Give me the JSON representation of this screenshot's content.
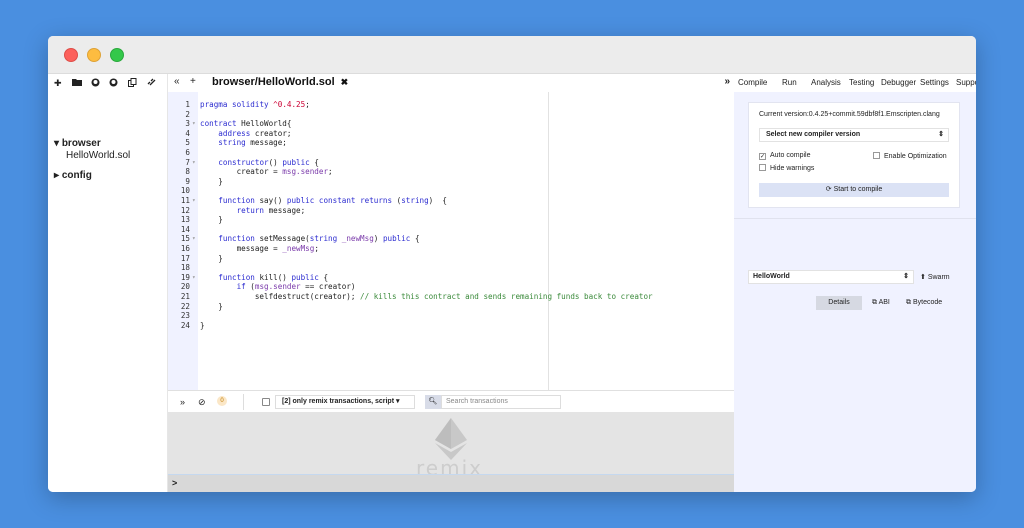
{
  "window": {
    "traffic_lights": [
      "close",
      "minimize",
      "maximize"
    ]
  },
  "explorer": {
    "toolbar_icons": [
      "plus-icon",
      "folder-open-icon",
      "github-icon",
      "github-publish-icon",
      "copy-icon",
      "link-icon"
    ],
    "tree": [
      {
        "type": "folder",
        "label": "browser",
        "expanded": true
      },
      {
        "type": "file",
        "label": "HelloWorld.sol"
      },
      {
        "type": "folder",
        "label": "config",
        "expanded": false
      }
    ]
  },
  "editor": {
    "tab": {
      "label": "browser/HelloWorld.sol",
      "close": "✖"
    },
    "lines": [
      "pragma solidity ^0.4.25;",
      "",
      "contract HelloWorld{",
      "    address creator;",
      "    string message;",
      "",
      "    constructor() public {",
      "        creator = msg.sender;",
      "    }",
      "",
      "    function say() public constant returns (string)  {",
      "        return message;",
      "    }",
      "",
      "    function setMessage(string _newMsg) public {",
      "        message = _newMsg;",
      "    }",
      "",
      "    function kill() public {",
      "        if (msg.sender == creator)",
      "            selfdestruct(creator); // kills this contract and sends remaining funds back to creator",
      "    }",
      "",
      "}"
    ]
  },
  "terminal": {
    "pending_count": "0",
    "filter_label": "[2] only remix transactions, script",
    "search_placeholder": "Search transactions",
    "watermark": "remix",
    "prompt": ">"
  },
  "right_panel": {
    "tabs": [
      "Compile",
      "Run",
      "Analysis",
      "Testing",
      "Debugger",
      "Settings",
      "Support"
    ],
    "active_tab": "Compile",
    "current_version": "Current version:0.4.25+commit.59dbf8f1.Emscripten.clang",
    "select_version": "Select new compiler version",
    "auto_compile": "Auto compile",
    "enable_optimization": "Enable Optimization",
    "hide_warnings": "Hide warnings",
    "start_compile": "Start to compile",
    "contract": "HelloWorld",
    "swarm": "Swarm",
    "details": "Details",
    "abi": "ABI",
    "bytecode": "Bytecode"
  },
  "colors": {
    "background": "#4a8fe0",
    "panel": "#f0f2ff",
    "keyword": "#2c2cd0",
    "comment": "#3a8a3a"
  }
}
